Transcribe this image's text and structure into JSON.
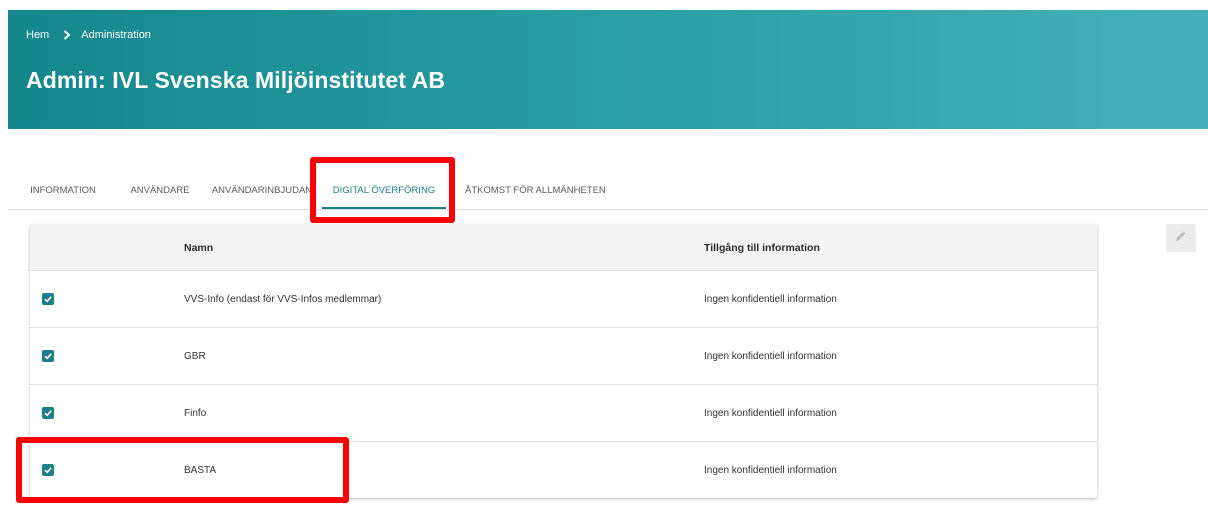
{
  "breadcrumb": {
    "home": "Hem",
    "current": "Administration",
    "separator_icon": "chevron-right-icon"
  },
  "page_title": "Admin: IVL Svenska Miljöinstitutet AB",
  "tabs": [
    {
      "label": "INFORMATION",
      "active": false
    },
    {
      "label": "ANVÄNDARE",
      "active": false
    },
    {
      "label": "ANVÄNDARINBJUDAN",
      "active": false
    },
    {
      "label": "DIGITAL ÖVERFÖRING",
      "active": true
    },
    {
      "label": "ÅTKOMST FÖR ALLMÄNHETEN",
      "active": false
    }
  ],
  "table": {
    "columns": [
      "Namn",
      "Tillgång till information"
    ],
    "rows": [
      {
        "checked": true,
        "name": "VVS-Info (endast för VVS-Infos medlemmar)",
        "access": "Ingen konfidentiell information"
      },
      {
        "checked": true,
        "name": "GBR",
        "access": "Ingen konfidentiell information"
      },
      {
        "checked": true,
        "name": "Finfo",
        "access": "Ingen konfidentiell information"
      },
      {
        "checked": true,
        "name": "BASTA",
        "access": "Ingen konfidentiell information"
      }
    ]
  },
  "icons": {
    "edit": "pencil-icon",
    "check": "checkbox-checked-icon"
  },
  "colors": {
    "header_start": "#15878c",
    "header_end": "#46b0b8",
    "accent": "#1d7f86",
    "highlight": "#ff0000"
  }
}
